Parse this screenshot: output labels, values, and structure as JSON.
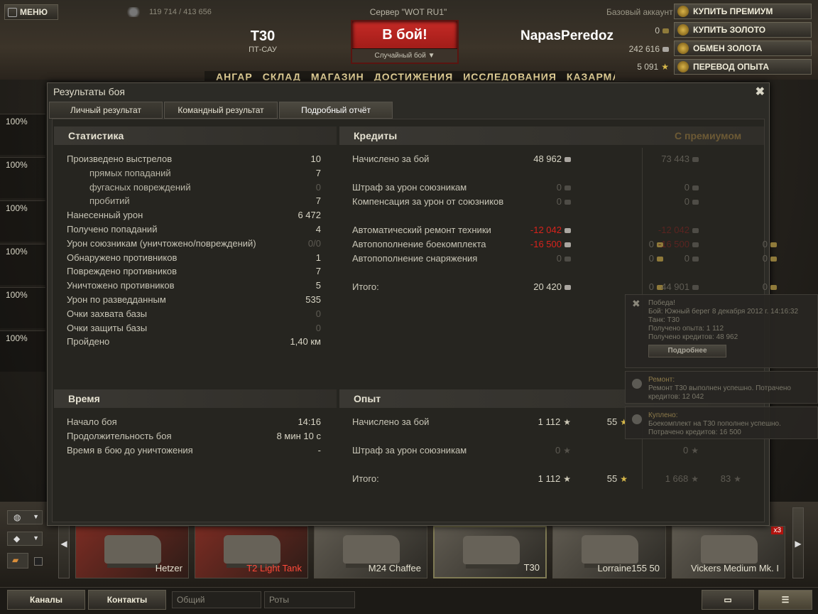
{
  "topbar": {
    "menu": "МЕНЮ",
    "online": "119 714 / 413 656",
    "server": "Сервер \"WOT RU1\"",
    "battle": "В бой!",
    "battle_mode": "Случайный бой",
    "tank": "T30",
    "tank_class": "ПТ-САУ",
    "player": "NapasPeredoz",
    "account": "Базовый аккаунт",
    "gold": "0",
    "credits": "242 616",
    "xp": "5 091",
    "btn_premium": "КУПИТЬ ПРЕМИУМ",
    "btn_gold": "КУПИТЬ ЗОЛОТО",
    "btn_exchange": "ОБМЕН ЗОЛОТА",
    "btn_xp": "ПЕРЕВОД ОПЫТА",
    "nav": [
      "АНГАР",
      "СКЛАД",
      "МАГАЗИН",
      "ДОСТИЖЕНИЯ",
      "ИССЛЕДОВАНИЯ",
      "КАЗАРМА"
    ]
  },
  "sidebar": {
    "pcts": [
      "100%",
      "100%",
      "100%",
      "100%",
      "100%",
      "100%"
    ]
  },
  "dialog": {
    "title": "Результаты боя",
    "tabs": [
      "Личный результат",
      "Командный результат",
      "Подробный отчёт"
    ],
    "stats": {
      "header": "Статистика",
      "rows": [
        {
          "label": "Произведено выстрелов",
          "value": "10"
        },
        {
          "label": "прямых попаданий",
          "value": "7"
        },
        {
          "label": "фугасных повреждений",
          "value": "0"
        },
        {
          "label": "пробитий",
          "value": "7"
        },
        {
          "label": "Нанесенный урон",
          "value": "6 472"
        },
        {
          "label": "Получено попаданий",
          "value": "4"
        },
        {
          "label": "Урон союзникам (уничтожено/повреждений)",
          "value": "0/0"
        },
        {
          "label": "Обнаружено противников",
          "value": "1"
        },
        {
          "label": "Повреждено противников",
          "value": "7"
        },
        {
          "label": "Уничтожено противников",
          "value": "5"
        },
        {
          "label": "Урон по разведданным",
          "value": "535"
        },
        {
          "label": "Очки захвата базы",
          "value": "0"
        },
        {
          "label": "Очки защиты базы",
          "value": "0"
        },
        {
          "label": "Пройдено",
          "value": "1,40 км"
        }
      ]
    },
    "time": {
      "header": "Время",
      "rows": [
        {
          "label": "Начало боя",
          "value": "14:16"
        },
        {
          "label": "Продолжительность боя",
          "value": "8 мин 10 с"
        },
        {
          "label": "Время в бою до уничтожения",
          "value": "-"
        }
      ]
    },
    "credits": {
      "header": "Кредиты",
      "premium_header": "С премиумом",
      "rows": [
        {
          "label": "Начислено за бой",
          "c": "48 962",
          "g": "",
          "pc": "73 443",
          "pg": ""
        },
        {
          "label": "Штраф за урон союзникам",
          "c": "0",
          "g": "",
          "pc": "0",
          "pg": ""
        },
        {
          "label": "Компенсация за урон от союзников",
          "c": "0",
          "g": "",
          "pc": "0",
          "pg": ""
        },
        {
          "label": "Автоматический ремонт техники",
          "c": "-12 042",
          "g": "",
          "pc": "-12 042",
          "pg": ""
        },
        {
          "label": "Автопополнение боекомплекта",
          "c": "-16 500",
          "g": "0",
          "pc": "-16 500",
          "pg": "0"
        },
        {
          "label": "Автопополнение снаряжения",
          "c": "0",
          "g": "0",
          "pc": "0",
          "pg": "0"
        },
        {
          "label": "Итого:",
          "c": "20 420",
          "g": "0",
          "pc": "44 901",
          "pg": "0"
        }
      ]
    },
    "xp": {
      "header": "Опыт",
      "rows": [
        {
          "label": "Начислено за бой",
          "x": "1 112",
          "f": "55",
          "px": "",
          "pf": ""
        },
        {
          "label": "Штраф за урон союзникам",
          "x": "0",
          "f": "",
          "px": "0",
          "pf": ""
        },
        {
          "label": "Итого:",
          "x": "1 112",
          "f": "55",
          "px": "1 668",
          "pf": "83"
        }
      ]
    }
  },
  "notifications": [
    {
      "lines": [
        "Победа!",
        "Бой: Южный берег 8 декабря 2012 г. 14:16:32",
        "Танк: T30",
        "Получено опыта: 1 112",
        "Получено кредитов: 48 962"
      ],
      "button": "Подробнее"
    },
    {
      "lines": [
        "Ремонт:",
        "Ремонт T30 выполнен успешно. Потрачено",
        "кредитов:  12 042"
      ]
    },
    {
      "lines": [
        "Куплено:",
        "Боекомплект на T30 пополнен успешно.",
        "Потрачено кредитов:  16 500"
      ]
    }
  ],
  "carousel": [
    {
      "name": "Hetzer",
      "badge": ""
    },
    {
      "name": "T2 Light Tank",
      "badge": ""
    },
    {
      "name": "M24 Chaffee",
      "badge": ""
    },
    {
      "name": "T30",
      "badge": ""
    },
    {
      "name": "Lorraine155 50",
      "badge": ""
    },
    {
      "name": "Vickers Medium Mk. I",
      "badge": "x3"
    }
  ],
  "bottombar": {
    "channels": "Каналы",
    "contacts": "Контакты",
    "general": "Общий",
    "companies": "Роты"
  }
}
